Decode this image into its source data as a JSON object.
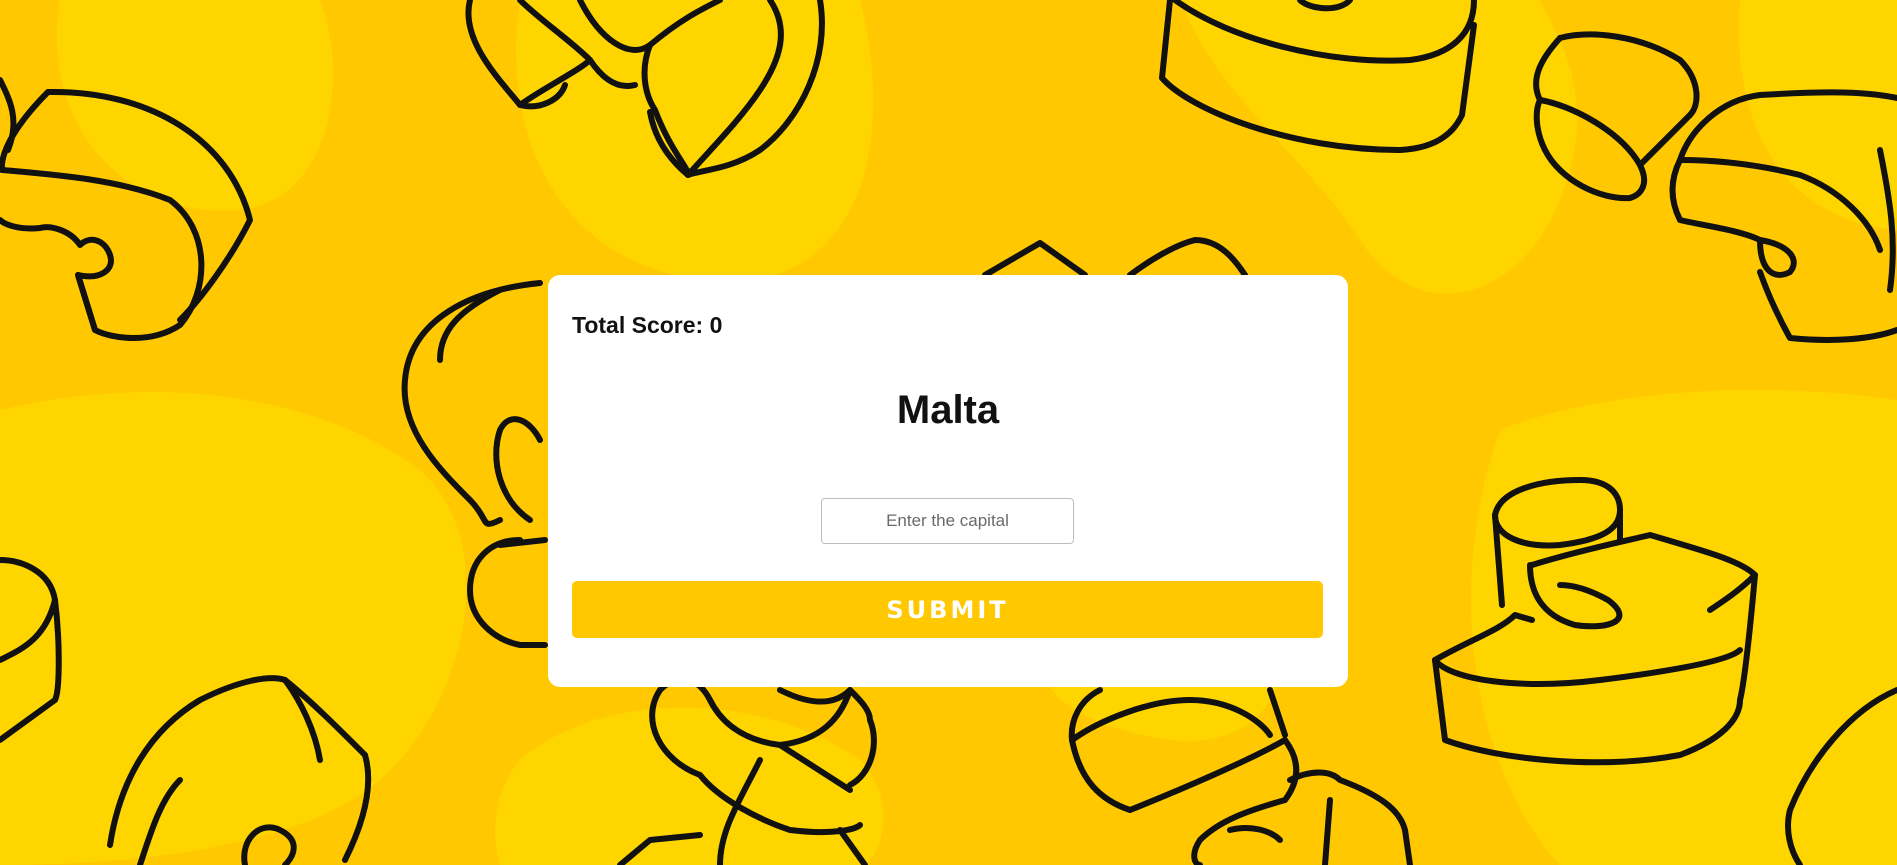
{
  "game": {
    "score_text": "Total Score: 0",
    "country": "Malta",
    "input_value": "",
    "input_placeholder": "Enter the capital",
    "submit_label": "SUBMIT"
  },
  "colors": {
    "background": "#ffc800",
    "card": "#ffffff",
    "accent": "#ffc800",
    "outline": "#111111"
  }
}
